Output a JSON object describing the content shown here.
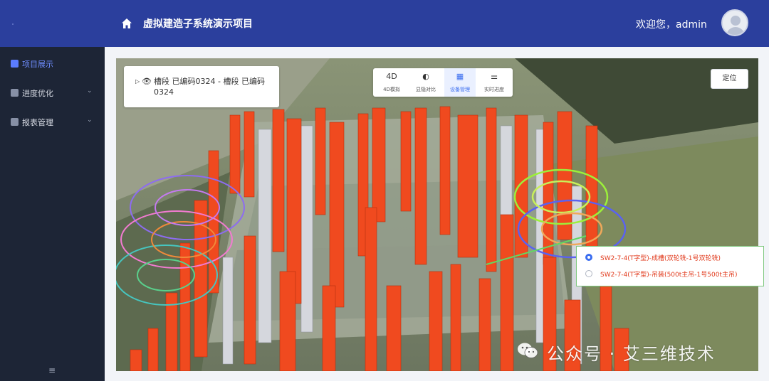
{
  "header": {
    "title": "虚拟建造子系统演示项目",
    "welcome": "欢迎您，admin",
    "brand_color": "#2b3f9d"
  },
  "sidebar": {
    "items": [
      {
        "label": "项目展示",
        "icon": "monitor-icon",
        "active": true
      },
      {
        "label": "进度优化",
        "icon": "progress-icon",
        "expandable": true
      },
      {
        "label": "报表管理",
        "icon": "report-icon",
        "expandable": true
      }
    ],
    "collapse_icon": "≡"
  },
  "layer_panel": {
    "text": "槽段 已编码0324 - 槽段 已编码0324"
  },
  "toolbar": {
    "items": [
      {
        "icon_text": "4D",
        "label": "4D模拟"
      },
      {
        "icon_text": "◐",
        "label": "显隐对比"
      },
      {
        "icon_text": "▦",
        "label": "设备管理",
        "active": true
      },
      {
        "icon_text": "⚌",
        "label": "实时进度"
      }
    ]
  },
  "locate_button": "定位",
  "equipment_list": {
    "options": [
      {
        "label": "SW2-7-4(T字型)-成槽(双轮铣-1号双轮铣)",
        "checked": true
      },
      {
        "label": "SW2-7-4(T字型)-吊装(500t主吊-1号500t主吊)",
        "checked": false
      }
    ],
    "text_color": "#e13a1c"
  },
  "watermark": {
    "text": "公众号 · 艾三维技术"
  }
}
